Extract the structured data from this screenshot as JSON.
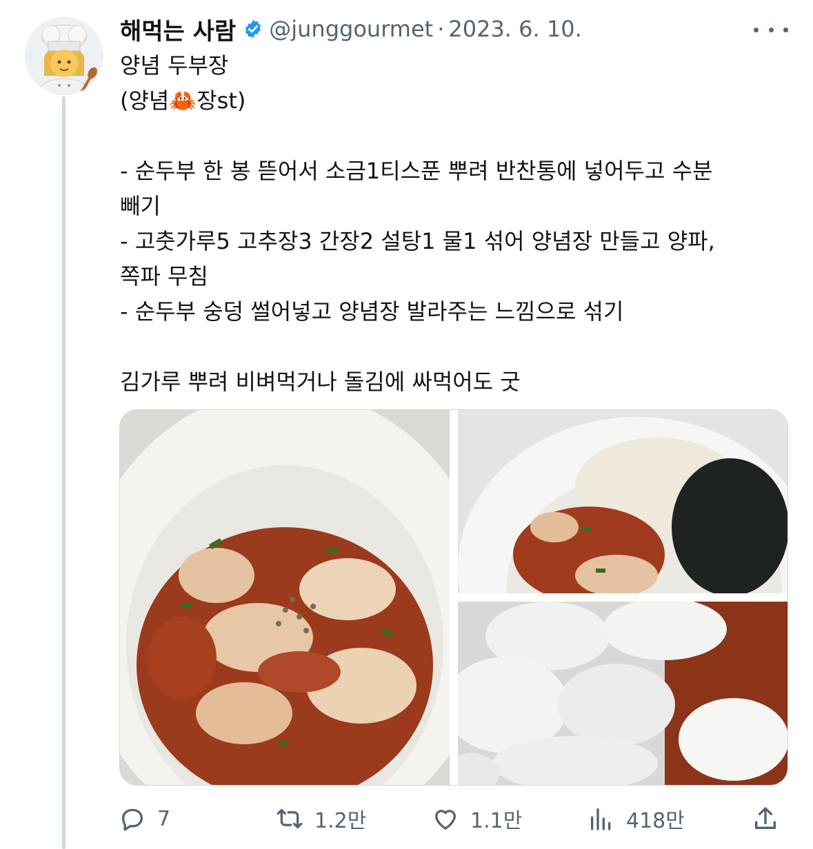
{
  "author": {
    "name": "해먹는 사람",
    "verified_icon": "verified-badge-icon",
    "handle": "@junggourmet",
    "separator": "·",
    "date": "2023. 6. 10.",
    "avatar_icon": "chef-woman-emoji"
  },
  "tweet": {
    "lines": [
      "양념 두부장",
      "(양념🦀장st)",
      "",
      "- 순두부 한 봉 뜯어서 소금1티스푼 뿌려 반찬통에 넣어두고 수분",
      "빼기",
      "- 고춧가루5 고추장3 간장2 설탕1 물1 섞어 양념장 만들고 양파,",
      "쪽파 무침",
      "- 순두부 숭덩 썰어넣고 양념장 발라주는 느낌으로 섞기",
      "",
      "김가루 뿌려 비벼먹거나 돌김에 싸먹어도 굿"
    ]
  },
  "media": {
    "photos": [
      "seasoned-tofu-bowl",
      "rice-with-seaweed-and-tofu",
      "soft-tofu-slices"
    ]
  },
  "actions": {
    "reply": {
      "icon": "reply-icon",
      "count": "7"
    },
    "retweet": {
      "icon": "retweet-icon",
      "count": "1.2만"
    },
    "like": {
      "icon": "heart-icon",
      "count": "1.1만"
    },
    "views": {
      "icon": "views-chart-icon",
      "count": "418만"
    },
    "share": {
      "icon": "share-icon"
    }
  },
  "colors": {
    "text": "#0f1419",
    "secondary": "#536471",
    "verified": "#1d9bf0",
    "border": "#cfd9de"
  }
}
